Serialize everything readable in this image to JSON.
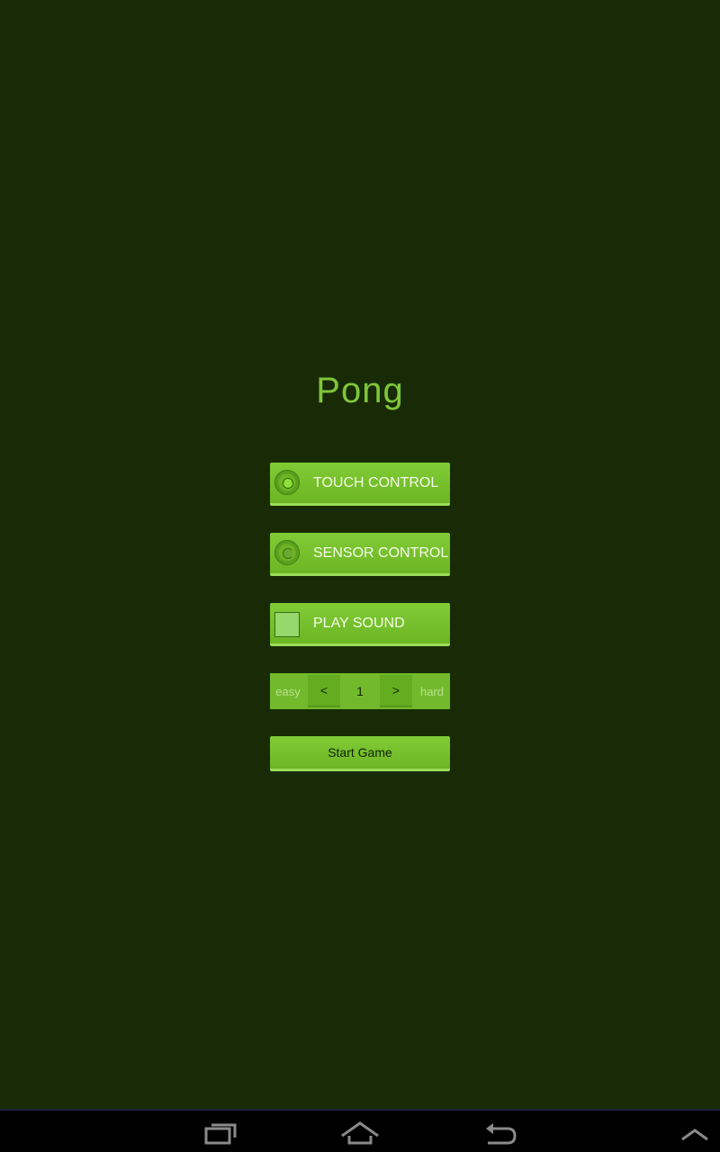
{
  "app": {
    "title": "Pong"
  },
  "options": {
    "touch_label": "TOUCH CONTROL",
    "touch_selected": true,
    "sensor_label": "SENSOR CONTROL",
    "sensor_selected": false,
    "sound_label": "PLAY SOUND",
    "sound_checked": false
  },
  "difficulty": {
    "min_label": "easy",
    "decrement_label": "<",
    "value": "1",
    "increment_label": ">",
    "max_label": "hard"
  },
  "actions": {
    "start_label": "Start Game"
  },
  "navbar": {
    "icons": [
      "recent-apps-icon",
      "home-icon",
      "back-icon",
      "expand-up-icon"
    ]
  },
  "colors": {
    "background": "#182b06",
    "accent": "#7fc63a",
    "button": "#74bd2c"
  }
}
